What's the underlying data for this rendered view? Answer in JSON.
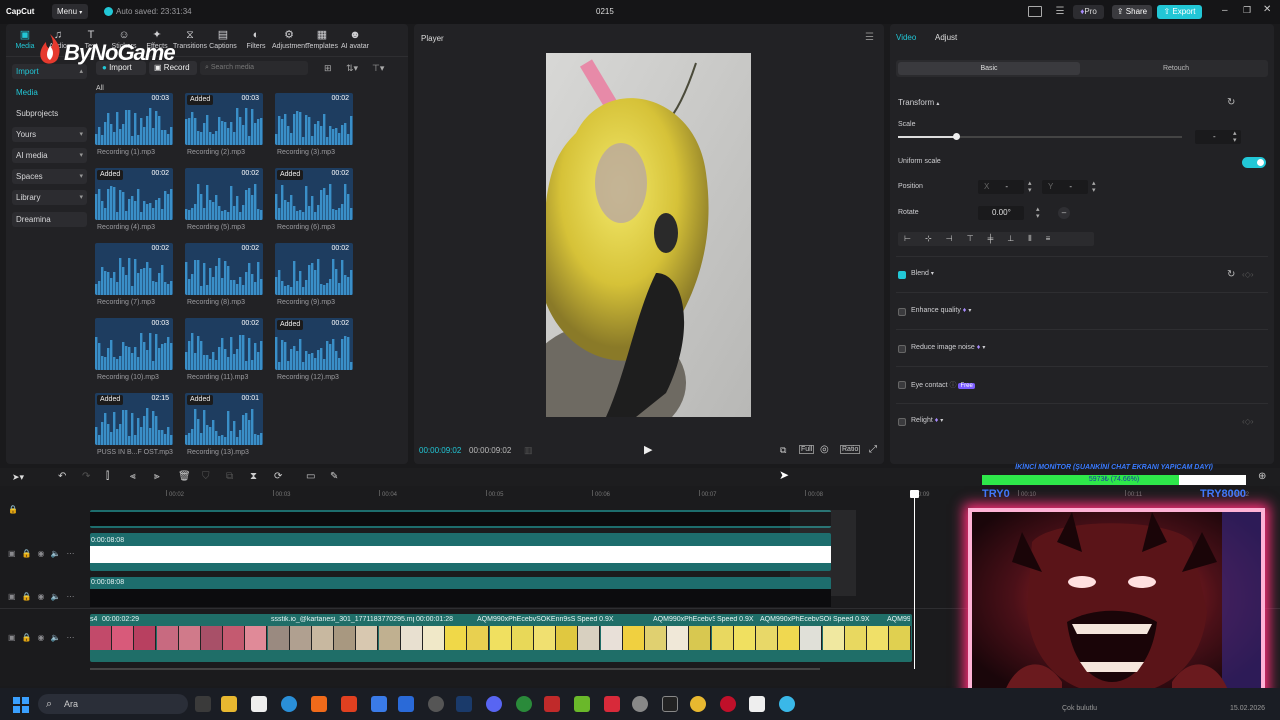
{
  "titlebar": {
    "app_name": "CapCut",
    "menu_label": "Menu",
    "autosave": "Auto saved: 23:31:34",
    "project_name": "0215",
    "pro_label": "Pro",
    "share_label": "Share",
    "export_label": "Export"
  },
  "overlay_logo": "ByNoGame",
  "toolbar_tabs": [
    {
      "label": "Media",
      "icon": "media-icon"
    },
    {
      "label": "Audio",
      "icon": "audio-icon"
    },
    {
      "label": "Text",
      "icon": "text-icon"
    },
    {
      "label": "Stickers",
      "icon": "sticker-icon"
    },
    {
      "label": "Effects",
      "icon": "effects-icon"
    },
    {
      "label": "Transitions",
      "icon": "transitions-icon"
    },
    {
      "label": "Captions",
      "icon": "captions-icon"
    },
    {
      "label": "Filters",
      "icon": "filters-icon"
    },
    {
      "label": "Adjustment",
      "icon": "adjustment-icon"
    },
    {
      "label": "Templates",
      "icon": "templates-icon"
    },
    {
      "label": "AI avatar",
      "icon": "ai-avatar-icon"
    }
  ],
  "sidebar": {
    "items": [
      {
        "label": "Import"
      },
      {
        "label": "Media"
      },
      {
        "label": "Subprojects"
      },
      {
        "label": "Yours"
      },
      {
        "label": "AI media"
      },
      {
        "label": "Spaces"
      },
      {
        "label": "Library"
      },
      {
        "label": "Dreamina"
      }
    ]
  },
  "media_toolbar": {
    "import_label": "Import",
    "record_label": "Record",
    "search_placeholder": "Search media",
    "all_label": "All"
  },
  "media_items": [
    {
      "name": "Recording (1).mp3",
      "duration": "00:03",
      "added": ""
    },
    {
      "name": "Recording (2).mp3",
      "duration": "00:03",
      "added": "Added"
    },
    {
      "name": "Recording (3).mp3",
      "duration": "00:02",
      "added": ""
    },
    {
      "name": "Recording (4).mp3",
      "duration": "00:02",
      "added": "Added"
    },
    {
      "name": "Recording (5).mp3",
      "duration": "00:02",
      "added": ""
    },
    {
      "name": "Recording (6).mp3",
      "duration": "00:02",
      "added": "Added"
    },
    {
      "name": "Recording (7).mp3",
      "duration": "00:02",
      "added": ""
    },
    {
      "name": "Recording (8).mp3",
      "duration": "00:02",
      "added": ""
    },
    {
      "name": "Recording (9).mp3",
      "duration": "00:02",
      "added": ""
    },
    {
      "name": "Recording (10).mp3",
      "duration": "00:03",
      "added": ""
    },
    {
      "name": "Recording (11).mp3",
      "duration": "00:02",
      "added": ""
    },
    {
      "name": "Recording (12).mp3",
      "duration": "00:02",
      "added": "Added"
    },
    {
      "name": "PUSS IN B...F OST.mp3",
      "duration": "02:15",
      "added": "Added"
    },
    {
      "name": "Recording (13).mp3",
      "duration": "00:01",
      "added": "Added"
    }
  ],
  "player": {
    "title": "Player",
    "current_time": "00:00:09:02",
    "total_time": "00:00:09:02",
    "full_label": "Full",
    "ratio_label": "Ratio"
  },
  "properties": {
    "tabs": [
      "Video",
      "Adjust"
    ],
    "subtabs": [
      "Basic",
      "Retouch"
    ],
    "transform_label": "Transform",
    "scale_label": "Scale",
    "scale_value": "-",
    "uniform_scale_label": "Uniform scale",
    "position_label": "Position",
    "pos_x_label": "X",
    "pos_x_value": "-",
    "pos_y_label": "Y",
    "pos_y_value": "-",
    "rotate_label": "Rotate",
    "rotate_value": "0.00°",
    "blend_label": "Blend",
    "enhance_label": "Enhance quality",
    "noise_label": "Reduce image noise",
    "eye_label": "Eye contact",
    "free_badge": "Free",
    "relight_label": "Relight",
    "uniform_scale_on": true
  },
  "timeline": {
    "ticks": [
      "00:02",
      "00:03",
      "00:04",
      "00:05",
      "00:06",
      "00:07",
      "00:08",
      "00:09",
      "00:10",
      "00:11",
      "00:12"
    ],
    "track2_time": "0:00:08:08",
    "track3_time": "0:00:08:08",
    "video_labels": [
      "s4",
      "00:00:02:29",
      "ssstik.io_@kartanesi_301_1771183770295.mp4",
      "00:00:01:28",
      "AQM990xPhEcebvSOKEnn9sS",
      "Speed 0.9X",
      "AQM990xPhEcebvSOKE",
      "Speed 0.9X",
      "AQM990xPhEcebvSOKE",
      "Speed 0.9X",
      "AQM99"
    ]
  },
  "stream_overlay": {
    "goal_title": "İKİNCİ MONİTOR (ŞUANKİNİ CHAT EKRANI YAPICAM DAYI)",
    "goal_progress_text": "5973₺ (74.66%)",
    "goal_progress": 0.7466,
    "goal_min": "TRY0",
    "goal_max": "TRY8000"
  },
  "taskbar": {
    "search_label": "Ara",
    "weather": "Çok bulutlu",
    "date": "15.02.2026"
  },
  "colors": {
    "accent": "#22c7d6",
    "share_bg": "#3a3a3e",
    "export_bg": "#22c7d6",
    "audio_thumb": "#1e3d60",
    "clip_teal": "#1d6d6d",
    "goal_green": "#2ee84a",
    "goal_blue": "#3a7bff",
    "overlay_pink": "#ff2f7a"
  }
}
